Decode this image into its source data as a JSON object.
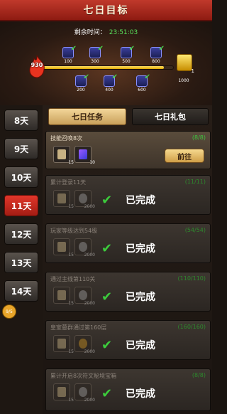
{
  "header": {
    "title": "七日目标"
  },
  "timer": {
    "label": "剩余时间：",
    "value": "23:51:03"
  },
  "progress": {
    "current": "930",
    "milestones": [
      "100",
      "200",
      "300",
      "400",
      "500",
      "600",
      "800",
      "1000"
    ],
    "chest_count": "1",
    "chest_value": "1000"
  },
  "days": [
    "8天",
    "9天",
    "10天",
    "11天",
    "12天",
    "13天",
    "14天"
  ],
  "active_day": "11天",
  "badge": "9/5",
  "tabs": {
    "tasks": "七日任务",
    "gifts": "七日礼包"
  },
  "tasks": [
    {
      "name": "技能召唤8次",
      "progress": "(8/8)",
      "reward1": "15",
      "reward2": "10",
      "action": "前往",
      "status": ""
    },
    {
      "name": "累计登录11天",
      "progress": "(11/11)",
      "reward1": "15",
      "reward2": "2000",
      "status": "已完成"
    },
    {
      "name": "玩家等级达到54级",
      "progress": "(54/54)",
      "reward1": "15",
      "reward2": "2000",
      "status": "已完成"
    },
    {
      "name": "通过主线第110关",
      "progress": "(110/110)",
      "reward1": "15",
      "reward2": "2000",
      "status": "已完成"
    },
    {
      "name": "皇室墓群通过第160层",
      "progress": "(160/160)",
      "reward1": "15",
      "reward2": "2000",
      "status": "已完成"
    },
    {
      "name": "累计开启8次符文秘境宝箱",
      "progress": "(8/8)",
      "reward1": "15",
      "reward2": "2000",
      "status": "已完成"
    }
  ],
  "colors": {
    "accent": "#c0392b",
    "complete": "#3ccc3c",
    "gold": "#e0a800"
  }
}
